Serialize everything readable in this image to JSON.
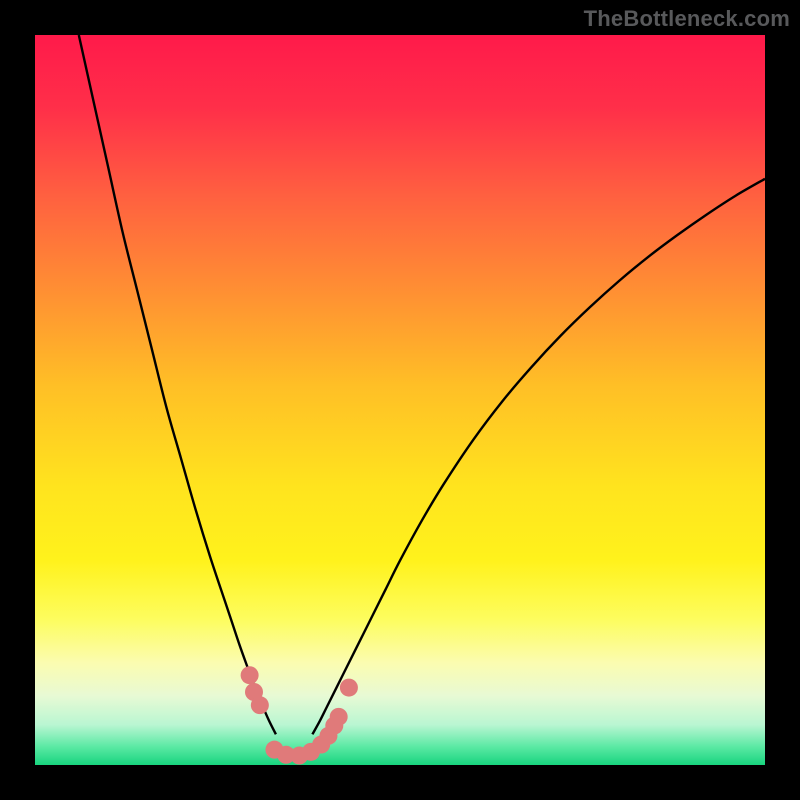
{
  "watermark": "TheBottleneck.com",
  "gradient": {
    "stops": [
      {
        "offset": 0.0,
        "color": "#ff1a4a"
      },
      {
        "offset": 0.1,
        "color": "#ff2f49"
      },
      {
        "offset": 0.22,
        "color": "#ff6040"
      },
      {
        "offset": 0.35,
        "color": "#ff8f33"
      },
      {
        "offset": 0.48,
        "color": "#ffbf26"
      },
      {
        "offset": 0.62,
        "color": "#ffe41e"
      },
      {
        "offset": 0.72,
        "color": "#fff21c"
      },
      {
        "offset": 0.8,
        "color": "#fdfd5e"
      },
      {
        "offset": 0.86,
        "color": "#fbfcb0"
      },
      {
        "offset": 0.905,
        "color": "#e8fad4"
      },
      {
        "offset": 0.945,
        "color": "#b9f6d2"
      },
      {
        "offset": 0.975,
        "color": "#5be9a4"
      },
      {
        "offset": 1.0,
        "color": "#18d47e"
      }
    ]
  },
  "chart_data": {
    "type": "line",
    "title": "",
    "xlabel": "",
    "ylabel": "",
    "xlim": [
      0,
      100
    ],
    "ylim": [
      0,
      100
    ],
    "series": [
      {
        "name": "left-branch",
        "x": [
          6,
          8,
          10,
          12,
          14,
          16,
          18,
          20,
          22,
          24,
          26,
          27,
          28,
          29,
          30,
          31,
          32,
          33
        ],
        "y": [
          100,
          91,
          82,
          73,
          65,
          57,
          49,
          42,
          35,
          28.5,
          22.5,
          19.5,
          16.5,
          13.7,
          11,
          8.5,
          6.2,
          4.2
        ]
      },
      {
        "name": "right-branch",
        "x": [
          38,
          39,
          40,
          42,
          44,
          46,
          48,
          50,
          53,
          56,
          60,
          64,
          68,
          72,
          76,
          80,
          84,
          88,
          92,
          96,
          100
        ],
        "y": [
          4.2,
          6.0,
          8.0,
          12.0,
          16.0,
          20.0,
          24.0,
          28.0,
          33.5,
          38.5,
          44.5,
          49.8,
          54.5,
          58.8,
          62.7,
          66.3,
          69.6,
          72.6,
          75.4,
          78.0,
          80.3
        ]
      }
    ],
    "markers": [
      {
        "name": "left-dot-1",
        "x": 29.4,
        "y": 12.3
      },
      {
        "name": "left-dot-2",
        "x": 30.0,
        "y": 10.0
      },
      {
        "name": "left-dot-3",
        "x": 30.8,
        "y": 8.2
      },
      {
        "name": "floor-1",
        "x": 32.8,
        "y": 2.1
      },
      {
        "name": "floor-2",
        "x": 34.4,
        "y": 1.4
      },
      {
        "name": "floor-3",
        "x": 36.2,
        "y": 1.3
      },
      {
        "name": "floor-4",
        "x": 37.8,
        "y": 1.8
      },
      {
        "name": "floor-5",
        "x": 39.2,
        "y": 2.8
      },
      {
        "name": "floor-6",
        "x": 40.2,
        "y": 4.0
      },
      {
        "name": "floor-7",
        "x": 41.0,
        "y": 5.4
      },
      {
        "name": "floor-8",
        "x": 41.6,
        "y": 6.6
      },
      {
        "name": "right-dot-1",
        "x": 43.0,
        "y": 10.6
      }
    ],
    "marker_radius_px": 9,
    "marker_color": "#e07a7a"
  }
}
